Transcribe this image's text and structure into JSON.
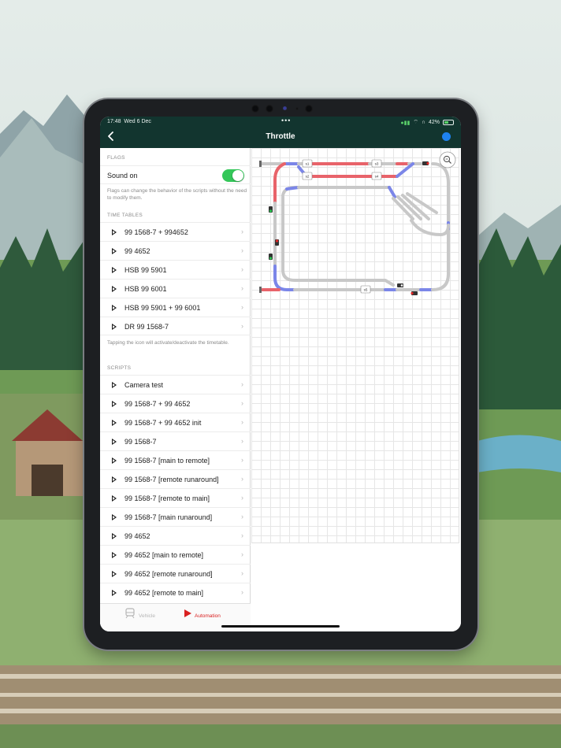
{
  "status_bar": {
    "time": "17:48",
    "date": "Wed 6 Dec",
    "battery": "42%"
  },
  "header": {
    "title": "Throttle"
  },
  "flags": {
    "section": "FLAGS",
    "sound_label": "Sound on",
    "sound_on": true,
    "note": "Flags can change the behavior of the scripts without the need to modify them."
  },
  "timetables": {
    "section": "TIME TABLES",
    "items": [
      "99 1568-7 + 994652",
      "99 4652",
      "HSB 99 5901",
      "HSB 99 6001",
      "HSB 99 5901 + 99 6001",
      "DR 99 1568-7"
    ],
    "note": "Tapping the icon will activate/deactivate the timetable."
  },
  "scripts": {
    "section": "SCRIPTS",
    "items": [
      "Camera test",
      "99 1568-7 + 99 4652",
      "99 1568-7 + 99 4652 init",
      "99 1568-7",
      "99 1568-7 [main to remote]",
      "99 1568-7 [remote runaround]",
      "99 1568-7 [remote to main]",
      "99 1568-7 [main runaround]",
      "99 4652",
      "99 4652 [main to remote]",
      "99 4652 [remote runaround]",
      "99 4652 [remote to main]"
    ]
  },
  "tabbar": {
    "vehicle": "Vehicle",
    "automation": "Automation"
  },
  "layout_map": {
    "block_labels": [
      "s1",
      "s2",
      "s3",
      "s4",
      "s5"
    ]
  },
  "colors": {
    "header_bg": "#12352f",
    "accent_blue": "#1e82f0",
    "toggle_on": "#34c759",
    "automation_red": "#d92020",
    "track_red": "#e8636a",
    "track_blue": "#7b86e8",
    "track_grey": "#c8c8c8"
  }
}
